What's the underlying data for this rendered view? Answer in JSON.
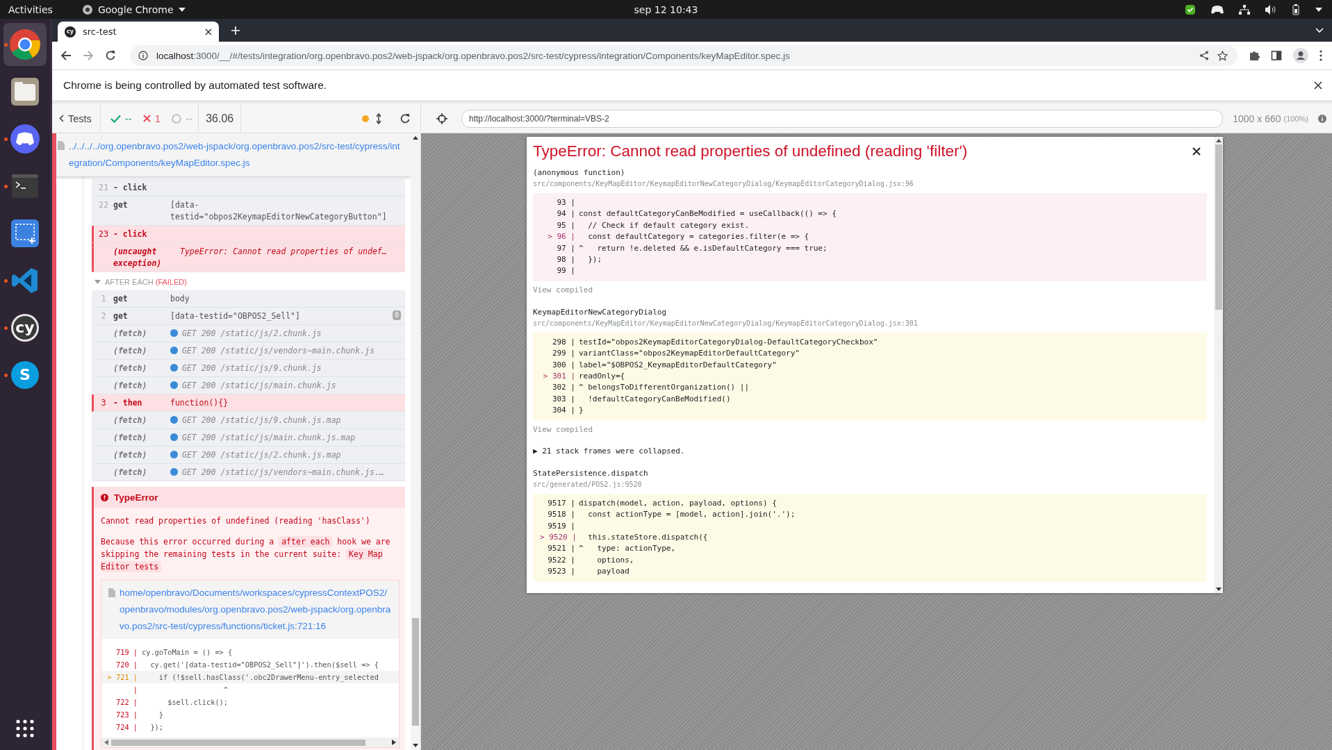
{
  "top_bar": {
    "activities": "Activities",
    "app_menu": "Google Chrome",
    "clock": "sep 12  10:43"
  },
  "dock": [
    {
      "kind": "chrome",
      "running": true,
      "selected": true
    },
    {
      "kind": "files",
      "running": false,
      "selected": false
    },
    {
      "kind": "discord",
      "running": true,
      "selected": false
    },
    {
      "kind": "terminal",
      "running": true,
      "selected": false
    },
    {
      "kind": "screenshot",
      "running": false,
      "selected": false
    },
    {
      "kind": "vscode",
      "running": true,
      "selected": false
    },
    {
      "kind": "cypress",
      "glyph": "cy",
      "running": true,
      "selected": false
    },
    {
      "kind": "skype",
      "glyph": "S",
      "running": true,
      "selected": false
    }
  ],
  "browser": {
    "tab": {
      "icon_text": "cy",
      "title": "src-test"
    },
    "url": {
      "host": "localhost",
      "rest": ":3000/__/#/tests/integration/org.openbravo.pos2/web-jspack/org.openbravo.pos2/src-test/cypress/integration/Components/keyMapEditor.spec.js"
    },
    "infobar": "Chrome is being controlled by automated test software."
  },
  "reporter": {
    "back": "Tests",
    "passed": "--",
    "failed": "1",
    "pending": "--",
    "duration": "36.06",
    "spec_path": "../../../../org.openbravo.pos2/web-jspack/org.openbravo.pos2/src-test/cypress/integration/Components/keyMapEditor.spec.js",
    "commands": [
      {
        "kind": "command",
        "num": "21",
        "name": "- click",
        "failed": false
      },
      {
        "kind": "command",
        "num": "22",
        "name": "get",
        "message": "[data-testid=\"obpos2KeymapEditorNewCategoryButton\"]",
        "failed": false
      },
      {
        "kind": "command",
        "num": "23",
        "name": "- click",
        "failed": true
      },
      {
        "kind": "exception",
        "name": "(uncaught exception)",
        "message": "TypeError: Cannot read properties of undef…",
        "failed": true
      }
    ],
    "hook": {
      "title": "AFTER EACH",
      "status": "(FAILED)"
    },
    "hook_commands": [
      {
        "kind": "command",
        "num": "1",
        "name": "get",
        "message": "body",
        "failed": false
      },
      {
        "kind": "command",
        "num": "2",
        "name": "get",
        "message": "[data-testid=\"OBPOS2_Sell\"]",
        "badge": "0",
        "failed": false
      },
      {
        "kind": "fetch",
        "name": "(fetch)",
        "message": "GET 200 /static/js/2.chunk.js",
        "failed": false
      },
      {
        "kind": "fetch",
        "name": "(fetch)",
        "message": "GET 200 /static/js/vendors~main.chunk.js",
        "failed": false
      },
      {
        "kind": "fetch",
        "name": "(fetch)",
        "message": "GET 200 /static/js/9.chunk.js",
        "failed": false
      },
      {
        "kind": "fetch",
        "name": "(fetch)",
        "message": "GET 200 /static/js/main.chunk.js",
        "failed": false
      },
      {
        "kind": "command",
        "num": "3",
        "name": "- then",
        "message": "function(){}",
        "failed": true
      },
      {
        "kind": "fetch",
        "name": "(fetch)",
        "message": "GET 200 /static/js/9.chunk.js.map",
        "failed": false
      },
      {
        "kind": "fetch",
        "name": "(fetch)",
        "message": "GET 200 /static/js/main.chunk.js.map",
        "failed": false
      },
      {
        "kind": "fetch",
        "name": "(fetch)",
        "message": "GET 200 /static/js/2.chunk.js.map",
        "failed": false
      },
      {
        "kind": "fetch",
        "name": "(fetch)",
        "message": "GET 200 /static/js/vendors~main.chunk.js.…",
        "failed": false
      }
    ],
    "error": {
      "title": "TypeError",
      "message": "Cannot read properties of undefined (reading 'hasClass')",
      "explanation": {
        "before": "Because this error occurred during a",
        "hook": "after each",
        "middle": "hook we are skipping the remaining tests in the current suite:",
        "suite": "Key Map Editor tests"
      },
      "file": "home/openbravo/Documents/workspaces/cypressContextPOS2/openbravo/modules/org.openbravo.pos2/web-jspack/org.openbravo.pos2/src-test/cypress/functions/ticket.js:721:16",
      "lines": [
        {
          "gutter": "719 |",
          "code": "cy.goToMain = () => {",
          "current": false
        },
        {
          "gutter": "720 |",
          "code": "  cy.get('[data-testid=\"OBPOS2_Sell\"]').then($sell => {",
          "current": false
        },
        {
          "gutter": "> 721 |",
          "code": "    if (!$sell.hasClass('.obc2DrawerMenu-entry_selected",
          "current": true
        },
        {
          "gutter": "|",
          "code": "                   ^",
          "current": false
        },
        {
          "gutter": "722 |",
          "code": "      $sell.click();",
          "current": false
        },
        {
          "gutter": "723 |",
          "code": "    }",
          "current": false
        },
        {
          "gutter": "724 |",
          "code": "  });",
          "current": false
        }
      ]
    }
  },
  "aut": {
    "url": "http://localhost:3000/?terminal=VBS-2",
    "size": "1000 x 660",
    "scale": "(100%)"
  },
  "overlay": {
    "title": "TypeError: Cannot read properties of undefined (reading 'filter')",
    "items": [
      {
        "kind": "frame",
        "function": "(anonymous function)",
        "file": "src/components/KeyMapEditor/KeymapEditorNewCategoryDialog/KeymapEditorCategoryDialog.jsx:96",
        "error": true,
        "lines": [
          {
            "gutter": "93 |",
            "current": false
          },
          {
            "gutter": "94 |",
            "code": "const defaultCategoryCanBeModified = useCallback(() => {",
            "current": false
          },
          {
            "gutter": "95 |",
            "code": "  // Check if default category exist.",
            "current": false
          },
          {
            "gutter": "> 96 |",
            "code": "  const defaultCategory = categories.filter(e => {",
            "current": true
          },
          {
            "gutter": "97 |",
            "code": "^   return !e.deleted && e.isDefaultCategory === true;",
            "current": false
          },
          {
            "gutter": "98 |",
            "code": "  });",
            "current": false
          },
          {
            "gutter": "99 |",
            "current": false
          }
        ]
      },
      {
        "kind": "link",
        "text": "View compiled"
      },
      {
        "kind": "frame",
        "function": "KeymapEditorNewCategoryDialog",
        "file": "src/components/KeyMapEditor/KeymapEditorNewCategoryDialog/KeymapEditorCategoryDialog.jsx:301",
        "error": false,
        "lines": [
          {
            "gutter": "298 |",
            "code": "testId=\"obpos2KeymapEditorCategoryDialog-DefaultCategoryCheckbox\"",
            "current": false
          },
          {
            "gutter": "299 |",
            "code": "variantClass=\"obpos2KeymapEditorDefaultCategory\"",
            "current": false
          },
          {
            "gutter": "300 |",
            "code": "label=\"$OBPOS2_KeymapEditorDefaultCategory\"",
            "current": false
          },
          {
            "gutter": "> 301 |",
            "code": "readOnly={",
            "current": true
          },
          {
            "gutter": "302 |",
            "code": "^ belongsToDifferentOrganization() ||",
            "current": false
          },
          {
            "gutter": "303 |",
            "code": "  !defaultCategoryCanBeModified()",
            "current": false
          },
          {
            "gutter": "304 |",
            "code": "}",
            "current": false
          }
        ]
      },
      {
        "kind": "link",
        "text": "View compiled"
      },
      {
        "kind": "collapsed",
        "text": "▶ 21 stack frames were collapsed."
      },
      {
        "kind": "frame",
        "function": "StatePersistence.dispatch",
        "file": "src/generated/POS2.js:9520",
        "error": false,
        "lines": [
          {
            "gutter": "9517 |",
            "code": "dispatch(model, action, payload, options) {",
            "current": false
          },
          {
            "gutter": "9518 |",
            "code": "  const actionType = [model, action].join('.');",
            "current": false
          },
          {
            "gutter": "9519 |",
            "current": false
          },
          {
            "gutter": "> 9520 |",
            "code": "  this.stateStore.dispatch({",
            "current": true
          },
          {
            "gutter": "9521 |",
            "code": "^   type: actionType,",
            "current": false
          },
          {
            "gutter": "9522 |",
            "code": "    options,",
            "current": false
          },
          {
            "gutter": "9523 |",
            "code": "    payload",
            "current": false
          }
        ]
      }
    ]
  }
}
